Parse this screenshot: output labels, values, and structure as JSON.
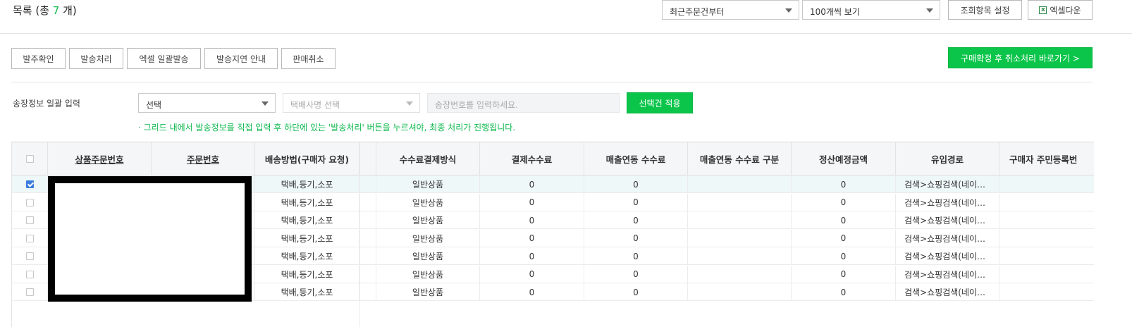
{
  "header": {
    "title_prefix": "목록 (총 ",
    "count": "7",
    "title_suffix": " 개)",
    "sort_select": "최근주문건부터",
    "page_size_select": "100개씩 보기",
    "columns_settings_label": "조회항목 설정",
    "excel_download_label": "엑셀다운",
    "excel_icon": "excel-icon"
  },
  "actions": {
    "confirm_order": "발주확인",
    "ship": "발송처리",
    "excel_bulk_ship": "엑셀 일괄발송",
    "ship_delay_notice": "발송지연 안내",
    "cancel_sale": "판매취소",
    "go_cancel_after_purchase": "구매확정 후 취소처리 바로가기 >"
  },
  "invoice": {
    "label": "송장정보 일괄 입력",
    "method_select": "선택",
    "courier_select": "택배사명 선택",
    "tracking_placeholder": "송장번호를 입력하세요.",
    "apply_label": "선택건 적용",
    "notice": "· 그리드 내에서 발송정보를 직접 입력 후 하단에 있는 '발송처리' 버튼을 누르셔야, 최종 처리가 진행됩니다."
  },
  "grid": {
    "columns": [
      "",
      "상품주문번호",
      "주문번호",
      "배송방법(구매자 요청)",
      "",
      "수수료결제방식",
      "결제수수료",
      "매출연동 수수료",
      "매출연동 수수료 구분",
      "정산예정금액",
      "유입경로",
      "구매자 주민등록번"
    ],
    "rows": [
      {
        "checked": true,
        "delivery": "택배,등기,소포",
        "fee_type": "일반상품",
        "pay_fee": "0",
        "sales_fee": "0",
        "sales_fee_type": "",
        "settle": "0",
        "inflow": "검색>쇼핑검색(네이…"
      },
      {
        "checked": false,
        "delivery": "택배,등기,소포",
        "fee_type": "일반상품",
        "pay_fee": "0",
        "sales_fee": "0",
        "sales_fee_type": "",
        "settle": "0",
        "inflow": "검색>쇼핑검색(네이…"
      },
      {
        "checked": false,
        "delivery": "택배,등기,소포",
        "fee_type": "일반상품",
        "pay_fee": "0",
        "sales_fee": "0",
        "sales_fee_type": "",
        "settle": "0",
        "inflow": "검색>쇼핑검색(네이…"
      },
      {
        "checked": false,
        "delivery": "택배,등기,소포",
        "fee_type": "일반상품",
        "pay_fee": "0",
        "sales_fee": "0",
        "sales_fee_type": "",
        "settle": "0",
        "inflow": "검색>쇼핑검색(네이…"
      },
      {
        "checked": false,
        "delivery": "택배,등기,소포",
        "fee_type": "일반상품",
        "pay_fee": "0",
        "sales_fee": "0",
        "sales_fee_type": "",
        "settle": "0",
        "inflow": "검색>쇼핑검색(네이…"
      },
      {
        "checked": false,
        "delivery": "택배,등기,소포",
        "fee_type": "일반상품",
        "pay_fee": "0",
        "sales_fee": "0",
        "sales_fee_type": "",
        "settle": "0",
        "inflow": "검색>쇼핑검색(네이…"
      },
      {
        "checked": false,
        "delivery": "택배,등기,소포",
        "fee_type": "일반상품",
        "pay_fee": "0",
        "sales_fee": "0",
        "sales_fee_type": "",
        "settle": "0",
        "inflow": "검색>쇼핑검색(네이…"
      }
    ]
  }
}
